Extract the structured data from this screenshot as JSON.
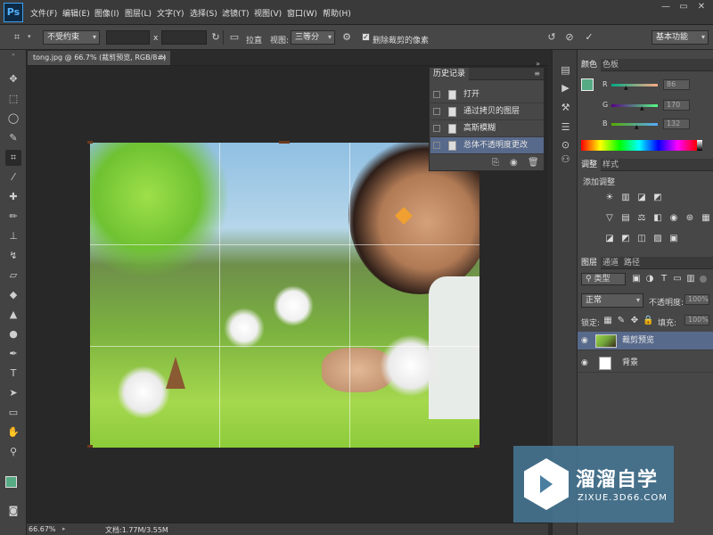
{
  "app": {
    "logo": "Ps"
  },
  "menu": [
    "文件(F)",
    "编辑(E)",
    "图像(I)",
    "图层(L)",
    "文字(Y)",
    "选择(S)",
    "滤镜(T)",
    "视图(V)",
    "窗口(W)",
    "帮助(H)"
  ],
  "window_controls": [
    "—",
    "▭",
    "✕"
  ],
  "options": {
    "ratio_dropdown": "不受约束",
    "x_separator": "x",
    "straighten_label": "拉直",
    "view_label": "视图:",
    "view_dropdown": "三等分",
    "delete_cropped_label": "删除裁剪的像素",
    "workspace_dropdown": "基本功能"
  },
  "document": {
    "tab_title": "tong.jpg @ 66.7% (裁剪预览, RGB/8#) *",
    "tab_close": "×"
  },
  "status": {
    "zoom": "66.67%",
    "doc_info": "文档:1.77M/3.55M"
  },
  "history": {
    "title": "历史记录",
    "items": [
      "打开",
      "通过拷贝的图层",
      "高斯模糊",
      "总体不透明度更改"
    ],
    "selected_index": 3
  },
  "color_panel": {
    "tabs": [
      "颜色",
      "色板"
    ],
    "channels": [
      {
        "label": "R",
        "value": "86"
      },
      {
        "label": "G",
        "value": "170"
      },
      {
        "label": "B",
        "value": "132"
      }
    ],
    "foreground_color": "#56aa84",
    "background_color": "#ffffff"
  },
  "adjustments_panel": {
    "tabs": [
      "调整",
      "样式"
    ],
    "title": "添加调整",
    "icons": [
      "brightness-icon",
      "levels-icon",
      "curves-icon",
      "exposure-icon",
      "vibrance-icon",
      "hue-icon",
      "color-balance-icon",
      "bw-icon",
      "photo-filter-icon",
      "channel-mixer-icon",
      "color-lookup-icon",
      "invert-icon",
      "posterize-icon",
      "threshold-icon",
      "gradient-map-icon",
      "selective-color-icon"
    ]
  },
  "layers_panel": {
    "tabs": [
      "图层",
      "通道",
      "路径"
    ],
    "filter_label": "类型",
    "blend_mode": "正常",
    "opacity_label": "不透明度:",
    "opacity_value": "100%",
    "lock_label": "锁定:",
    "fill_label": "填充:",
    "fill_value": "100%",
    "layers": [
      {
        "name": "裁剪预览",
        "selected": true
      },
      {
        "name": "背景",
        "selected": false
      }
    ]
  },
  "watermark": {
    "title": "溜溜自学",
    "url": "ZIXUE.3D66.COM"
  },
  "colors": {
    "accent_selected_row": "#586a8c",
    "crop_handle": "#6b3a1e"
  }
}
